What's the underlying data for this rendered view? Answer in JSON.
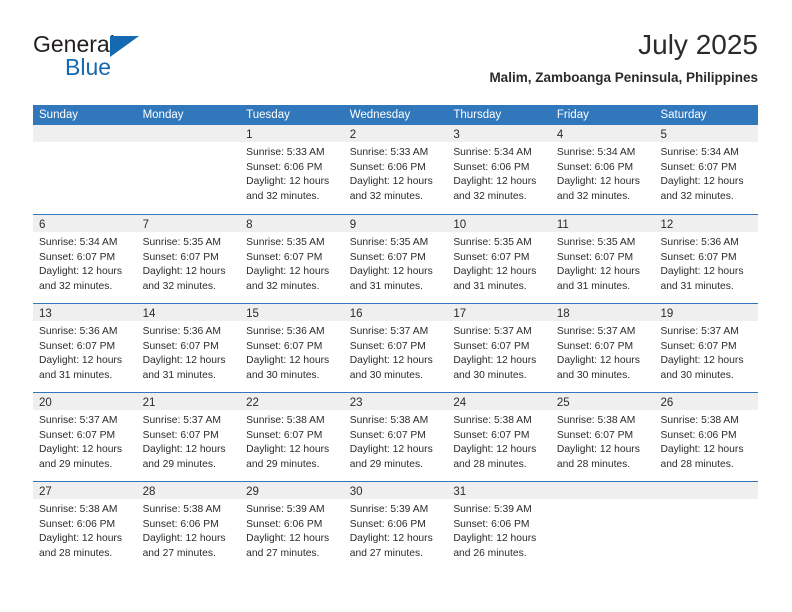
{
  "branding": {
    "logo_primary": "General",
    "logo_secondary": "Blue",
    "logo_primary_color": "#231f20",
    "logo_secondary_color": "#1569b0"
  },
  "header": {
    "title": "July 2025",
    "subtitle": "Malim, Zamboanga Peninsula, Philippines",
    "accent_color": "#3077bc",
    "day_band_color": "#efefef"
  },
  "weekdays": [
    "Sunday",
    "Monday",
    "Tuesday",
    "Wednesday",
    "Thursday",
    "Friday",
    "Saturday"
  ],
  "weeks": [
    [
      {
        "day": "",
        "lines": []
      },
      {
        "day": "",
        "lines": []
      },
      {
        "day": "1",
        "lines": [
          "Sunrise: 5:33 AM",
          "Sunset: 6:06 PM",
          "Daylight: 12 hours",
          "and 32 minutes."
        ]
      },
      {
        "day": "2",
        "lines": [
          "Sunrise: 5:33 AM",
          "Sunset: 6:06 PM",
          "Daylight: 12 hours",
          "and 32 minutes."
        ]
      },
      {
        "day": "3",
        "lines": [
          "Sunrise: 5:34 AM",
          "Sunset: 6:06 PM",
          "Daylight: 12 hours",
          "and 32 minutes."
        ]
      },
      {
        "day": "4",
        "lines": [
          "Sunrise: 5:34 AM",
          "Sunset: 6:06 PM",
          "Daylight: 12 hours",
          "and 32 minutes."
        ]
      },
      {
        "day": "5",
        "lines": [
          "Sunrise: 5:34 AM",
          "Sunset: 6:07 PM",
          "Daylight: 12 hours",
          "and 32 minutes."
        ]
      }
    ],
    [
      {
        "day": "6",
        "lines": [
          "Sunrise: 5:34 AM",
          "Sunset: 6:07 PM",
          "Daylight: 12 hours",
          "and 32 minutes."
        ]
      },
      {
        "day": "7",
        "lines": [
          "Sunrise: 5:35 AM",
          "Sunset: 6:07 PM",
          "Daylight: 12 hours",
          "and 32 minutes."
        ]
      },
      {
        "day": "8",
        "lines": [
          "Sunrise: 5:35 AM",
          "Sunset: 6:07 PM",
          "Daylight: 12 hours",
          "and 32 minutes."
        ]
      },
      {
        "day": "9",
        "lines": [
          "Sunrise: 5:35 AM",
          "Sunset: 6:07 PM",
          "Daylight: 12 hours",
          "and 31 minutes."
        ]
      },
      {
        "day": "10",
        "lines": [
          "Sunrise: 5:35 AM",
          "Sunset: 6:07 PM",
          "Daylight: 12 hours",
          "and 31 minutes."
        ]
      },
      {
        "day": "11",
        "lines": [
          "Sunrise: 5:35 AM",
          "Sunset: 6:07 PM",
          "Daylight: 12 hours",
          "and 31 minutes."
        ]
      },
      {
        "day": "12",
        "lines": [
          "Sunrise: 5:36 AM",
          "Sunset: 6:07 PM",
          "Daylight: 12 hours",
          "and 31 minutes."
        ]
      }
    ],
    [
      {
        "day": "13",
        "lines": [
          "Sunrise: 5:36 AM",
          "Sunset: 6:07 PM",
          "Daylight: 12 hours",
          "and 31 minutes."
        ]
      },
      {
        "day": "14",
        "lines": [
          "Sunrise: 5:36 AM",
          "Sunset: 6:07 PM",
          "Daylight: 12 hours",
          "and 31 minutes."
        ]
      },
      {
        "day": "15",
        "lines": [
          "Sunrise: 5:36 AM",
          "Sunset: 6:07 PM",
          "Daylight: 12 hours",
          "and 30 minutes."
        ]
      },
      {
        "day": "16",
        "lines": [
          "Sunrise: 5:37 AM",
          "Sunset: 6:07 PM",
          "Daylight: 12 hours",
          "and 30 minutes."
        ]
      },
      {
        "day": "17",
        "lines": [
          "Sunrise: 5:37 AM",
          "Sunset: 6:07 PM",
          "Daylight: 12 hours",
          "and 30 minutes."
        ]
      },
      {
        "day": "18",
        "lines": [
          "Sunrise: 5:37 AM",
          "Sunset: 6:07 PM",
          "Daylight: 12 hours",
          "and 30 minutes."
        ]
      },
      {
        "day": "19",
        "lines": [
          "Sunrise: 5:37 AM",
          "Sunset: 6:07 PM",
          "Daylight: 12 hours",
          "and 30 minutes."
        ]
      }
    ],
    [
      {
        "day": "20",
        "lines": [
          "Sunrise: 5:37 AM",
          "Sunset: 6:07 PM",
          "Daylight: 12 hours",
          "and 29 minutes."
        ]
      },
      {
        "day": "21",
        "lines": [
          "Sunrise: 5:37 AM",
          "Sunset: 6:07 PM",
          "Daylight: 12 hours",
          "and 29 minutes."
        ]
      },
      {
        "day": "22",
        "lines": [
          "Sunrise: 5:38 AM",
          "Sunset: 6:07 PM",
          "Daylight: 12 hours",
          "and 29 minutes."
        ]
      },
      {
        "day": "23",
        "lines": [
          "Sunrise: 5:38 AM",
          "Sunset: 6:07 PM",
          "Daylight: 12 hours",
          "and 29 minutes."
        ]
      },
      {
        "day": "24",
        "lines": [
          "Sunrise: 5:38 AM",
          "Sunset: 6:07 PM",
          "Daylight: 12 hours",
          "and 28 minutes."
        ]
      },
      {
        "day": "25",
        "lines": [
          "Sunrise: 5:38 AM",
          "Sunset: 6:07 PM",
          "Daylight: 12 hours",
          "and 28 minutes."
        ]
      },
      {
        "day": "26",
        "lines": [
          "Sunrise: 5:38 AM",
          "Sunset: 6:06 PM",
          "Daylight: 12 hours",
          "and 28 minutes."
        ]
      }
    ],
    [
      {
        "day": "27",
        "lines": [
          "Sunrise: 5:38 AM",
          "Sunset: 6:06 PM",
          "Daylight: 12 hours",
          "and 28 minutes."
        ]
      },
      {
        "day": "28",
        "lines": [
          "Sunrise: 5:38 AM",
          "Sunset: 6:06 PM",
          "Daylight: 12 hours",
          "and 27 minutes."
        ]
      },
      {
        "day": "29",
        "lines": [
          "Sunrise: 5:39 AM",
          "Sunset: 6:06 PM",
          "Daylight: 12 hours",
          "and 27 minutes."
        ]
      },
      {
        "day": "30",
        "lines": [
          "Sunrise: 5:39 AM",
          "Sunset: 6:06 PM",
          "Daylight: 12 hours",
          "and 27 minutes."
        ]
      },
      {
        "day": "31",
        "lines": [
          "Sunrise: 5:39 AM",
          "Sunset: 6:06 PM",
          "Daylight: 12 hours",
          "and 26 minutes."
        ]
      },
      {
        "day": "",
        "lines": []
      },
      {
        "day": "",
        "lines": []
      }
    ]
  ]
}
